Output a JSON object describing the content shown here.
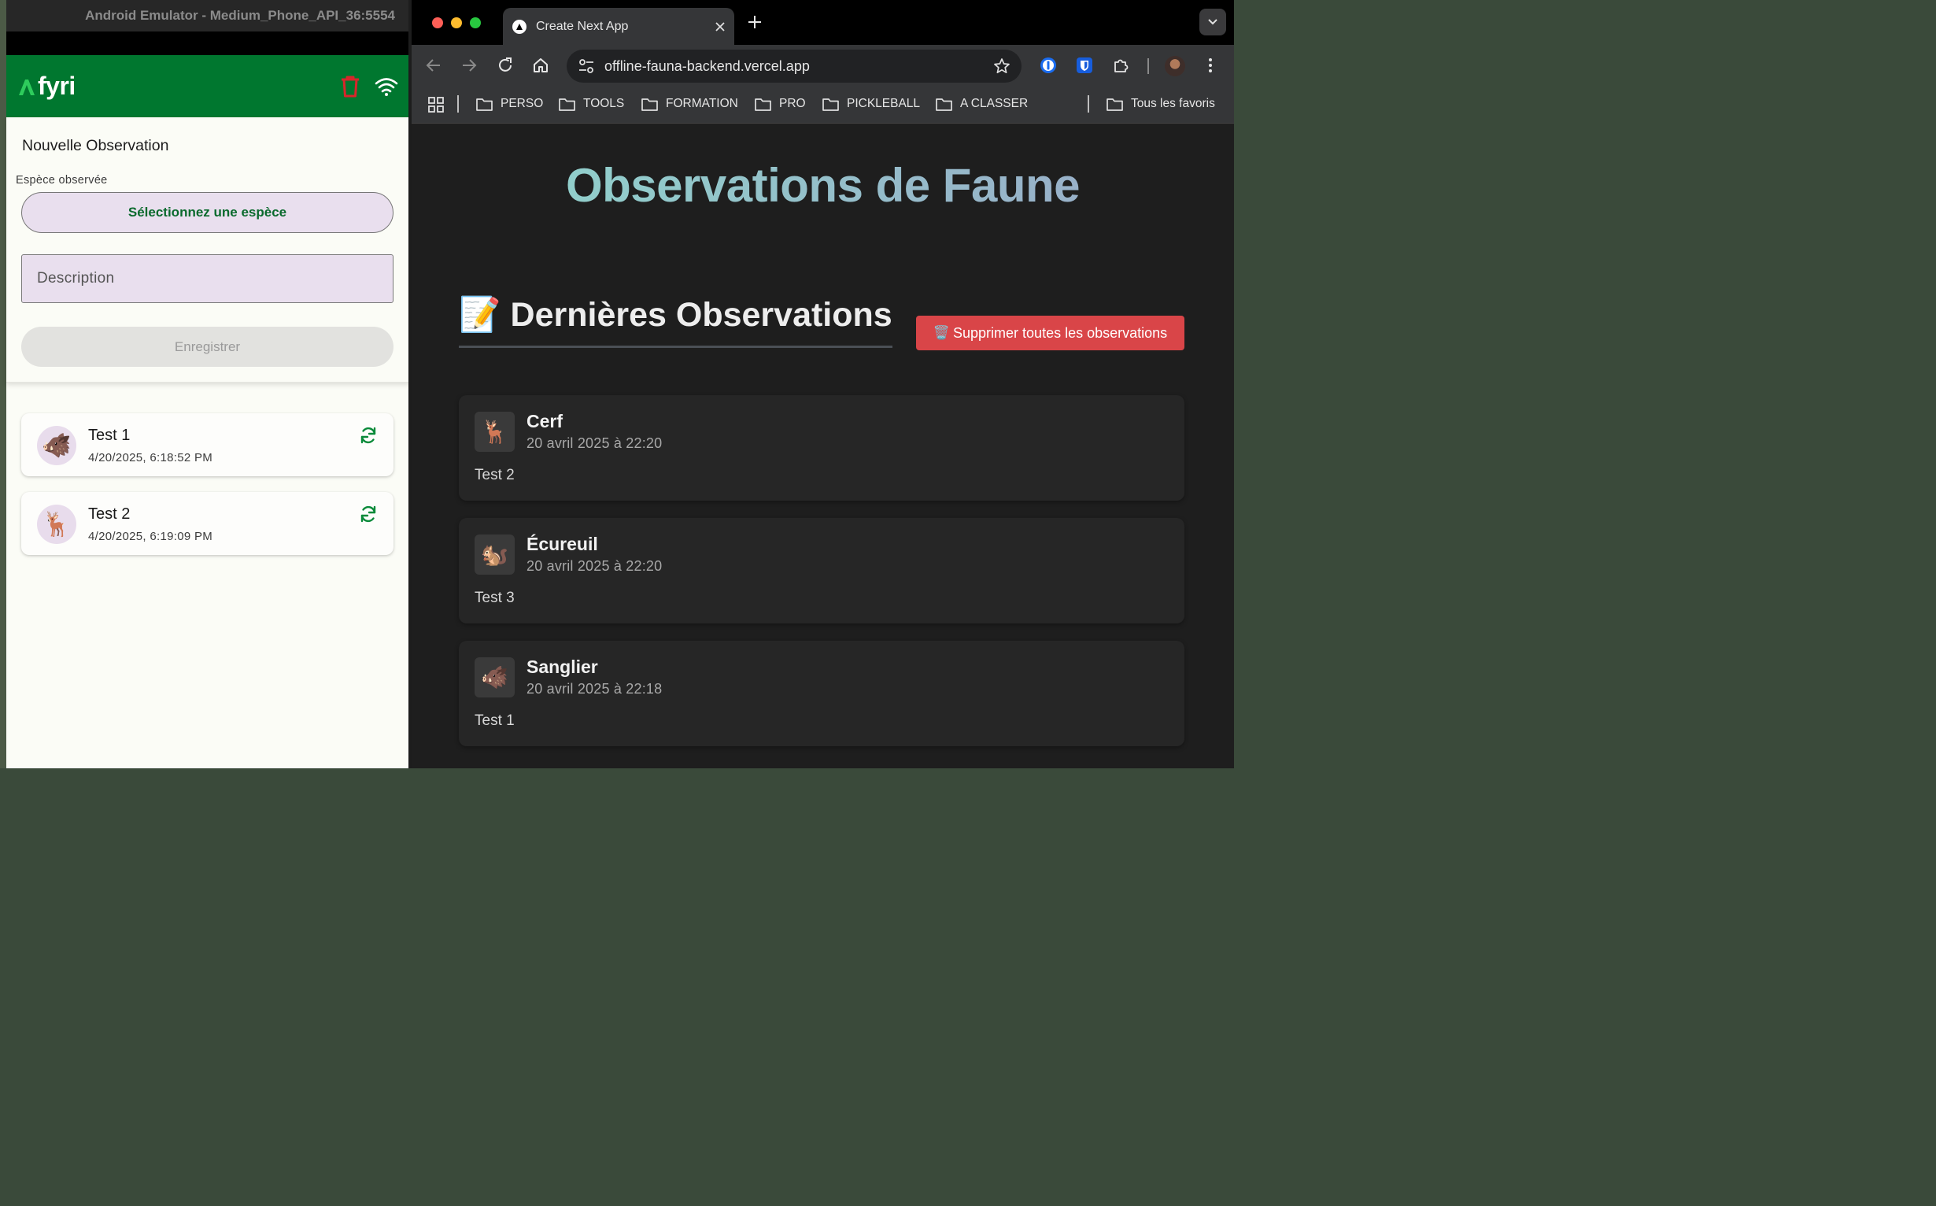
{
  "emulator": {
    "window_title": "Android Emulator - Medium_Phone_API_36:5554",
    "app": {
      "logo_text": "fyri",
      "brand_color": "#00772f",
      "form": {
        "title": "Nouvelle Observation",
        "species_label": "Espèce observée",
        "species_button": "Sélectionnez une espèce",
        "description_placeholder": "Description",
        "save_button": "Enregistrer"
      },
      "observations": [
        {
          "name": "Test 1",
          "date": "4/20/2025, 6:18:52 PM",
          "icon": "🐗"
        },
        {
          "name": "Test 2",
          "date": "4/20/2025, 6:19:09 PM",
          "icon": "🦌"
        }
      ]
    }
  },
  "browser": {
    "tab_title": "Create Next App",
    "url": "offline-fauna-backend.vercel.app",
    "bookmarks": [
      "PERSO",
      "TOOLS",
      "FORMATION",
      "PRO",
      "PICKLEBALL",
      "A CLASSER"
    ],
    "all_bookmarks": "Tous les favoris",
    "page": {
      "title": "Observations de Faune",
      "list_icon": "📝",
      "list_title": "Dernières Observations",
      "delete_icon": "🗑️",
      "delete_button": "Supprimer toutes les observations",
      "delete_color": "#d94548",
      "observations": [
        {
          "icon": "🦌",
          "name": "Cerf",
          "date": "20 avril 2025 à 22:20",
          "description": "Test 2"
        },
        {
          "icon": "🐿️",
          "name": "Écureuil",
          "date": "20 avril 2025 à 22:20",
          "description": "Test 3"
        },
        {
          "icon": "🐗",
          "name": "Sanglier",
          "date": "20 avril 2025 à 22:18",
          "description": "Test 1"
        }
      ]
    }
  }
}
